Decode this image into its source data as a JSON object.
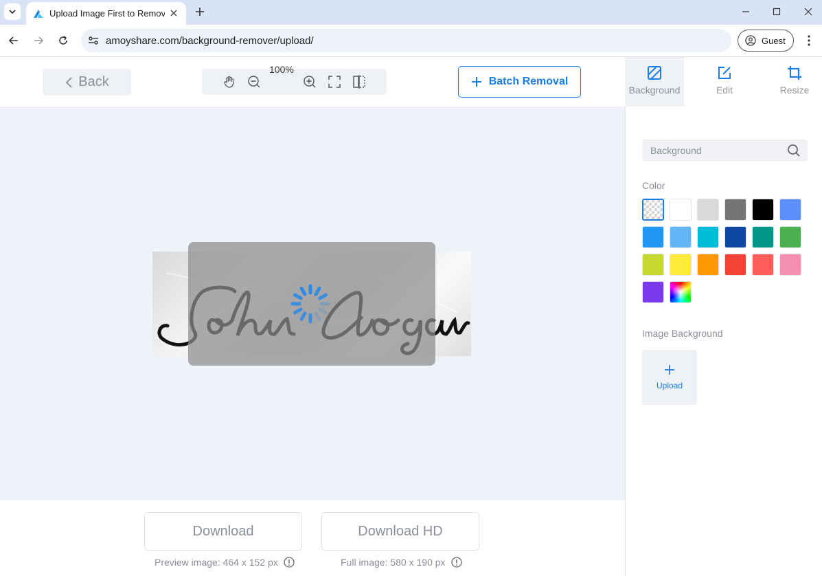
{
  "browser": {
    "tab_title": "Upload Image First to Remove Background",
    "url": "amoyshare.com/background-remover/upload/",
    "profile_label": "Guest"
  },
  "toolbar": {
    "back_label": "Back",
    "zoom_level": "100%",
    "batch_label": "Batch Removal"
  },
  "side_tabs": [
    {
      "label": "Background",
      "icon": "background-icon",
      "active": true
    },
    {
      "label": "Edit",
      "icon": "edit-icon",
      "active": false
    },
    {
      "label": "Resize",
      "icon": "crop-icon",
      "active": false
    }
  ],
  "image": {
    "signature_text": "John Logan",
    "loading": true
  },
  "download": {
    "download_label": "Download",
    "download_hd_label": "Download HD",
    "preview_note": "Preview image: 464 x 152 px",
    "full_note": "Full image: 580 x 190 px"
  },
  "panel": {
    "search_placeholder": "Background",
    "color_title": "Color",
    "image_bg_title": "Image Background",
    "upload_label": "Upload",
    "colors": [
      "transparent",
      "#ffffff",
      "#d9d9d9",
      "#757575",
      "#000000",
      "#5b8ff9",
      "#2196f3",
      "#64b5f6",
      "#00bcd4",
      "#0d47a1",
      "#009688",
      "#4caf50",
      "#c6d92f",
      "#ffeb3b",
      "#ff9800",
      "#f44336",
      "#ff5e5b",
      "#f48fb1",
      "#7c3aed",
      "gradient"
    ]
  },
  "accent_color": "#1a7ee8"
}
